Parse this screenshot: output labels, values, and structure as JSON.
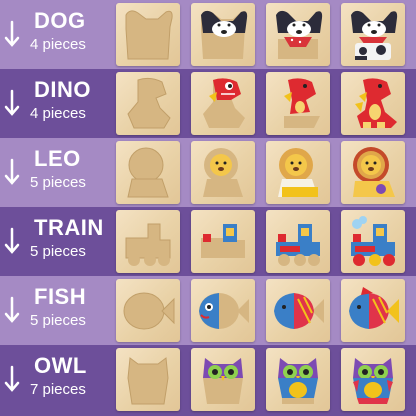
{
  "rows": [
    {
      "name": "DOG",
      "pieces": "4 pieces"
    },
    {
      "name": "DINO",
      "pieces": "4 pieces"
    },
    {
      "name": "LEO",
      "pieces": "5 pieces"
    },
    {
      "name": "TRAIN",
      "pieces": "5 pieces"
    },
    {
      "name": "FISH",
      "pieces": "5 pieces"
    },
    {
      "name": "OWL",
      "pieces": "7 pieces"
    }
  ],
  "icons": {
    "row_arrow": "arrow-down-icon"
  },
  "colors": {
    "row_light": "#a58ac4",
    "row_dark": "#6d4f9a",
    "text": "#ffffff"
  }
}
